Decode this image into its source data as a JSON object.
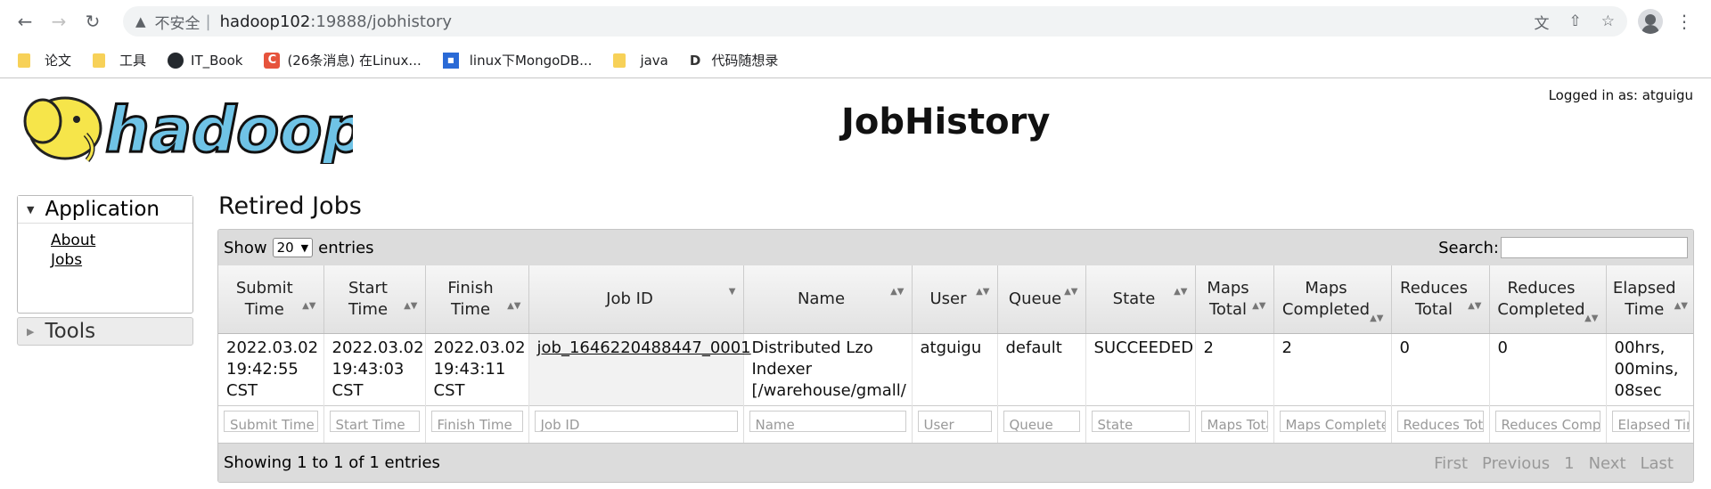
{
  "browser": {
    "insecure_label": "不安全",
    "separator": "|",
    "url_host": "hadoop102",
    "url_rest": ":19888/jobhistory",
    "bookmarks": [
      {
        "label": "论文",
        "icon": "folder-icon"
      },
      {
        "label": "工具",
        "icon": "folder-icon"
      },
      {
        "label": "IT_Book",
        "icon": "github-icon"
      },
      {
        "label": "(26条消息) 在Linux...",
        "icon": "csdn-icon"
      },
      {
        "label": "linux下MongoDB...",
        "icon": "cnblogs-icon"
      },
      {
        "label": "java",
        "icon": "folder-icon"
      },
      {
        "label": "代码随想录",
        "icon": "d-icon"
      }
    ]
  },
  "header": {
    "title": "JobHistory",
    "logged_in": "Logged in as: atguigu",
    "logo_text": "hadoop"
  },
  "sidebar": {
    "application_label": "Application",
    "links": [
      "About",
      "Jobs"
    ],
    "tools_label": "Tools"
  },
  "main": {
    "section_title": "Retired Jobs",
    "show_label": "Show",
    "show_value": "20",
    "entries_label": "entries",
    "search_label": "Search:",
    "columns": [
      "Submit Time",
      "Start Time",
      "Finish Time",
      "Job ID",
      "Name",
      "User",
      "Queue",
      "State",
      "Maps Total",
      "Maps Completed",
      "Reduces Total",
      "Reduces Completed",
      "Elapsed Time"
    ],
    "rows": [
      {
        "submit_time": "2022.03.02 19:42:55 CST",
        "start_time": "2022.03.02 19:43:03 CST",
        "finish_time": "2022.03.02 19:43:11 CST",
        "job_id": "job_1646220488447_0001",
        "name": "Distributed Lzo Indexer [/warehouse/gmall/",
        "user": "atguigu",
        "queue": "default",
        "state": "SUCCEEDED",
        "maps_total": "2",
        "maps_completed": "2",
        "reduces_total": "0",
        "reduces_completed": "0",
        "elapsed_time": "00hrs, 00mins, 08sec"
      }
    ],
    "filter_placeholders": [
      "Submit Time",
      "Start Time",
      "Finish Time",
      "Job ID",
      "Name",
      "User",
      "Queue",
      "State",
      "Maps Tota",
      "Maps Complete",
      "Reduces Tot",
      "Reduces Comp",
      "Elapsed Tin"
    ],
    "footer_info": "Showing 1 to 1 of 1 entries",
    "pager": [
      "First",
      "Previous",
      "1",
      "Next",
      "Last"
    ]
  }
}
